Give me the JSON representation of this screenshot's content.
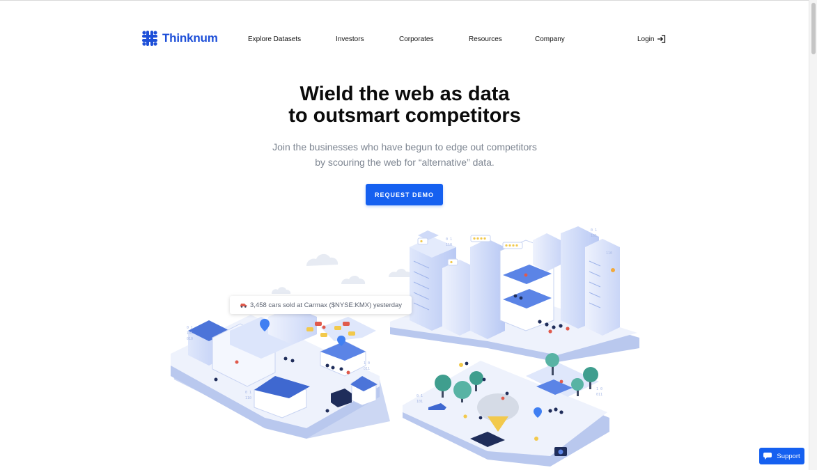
{
  "brand": {
    "name": "Thinknum",
    "color": "#1d4fd8"
  },
  "nav": {
    "items": [
      {
        "label": "Explore Datasets"
      },
      {
        "label": "Investors"
      },
      {
        "label": "Corporates"
      },
      {
        "label": "Resources"
      },
      {
        "label": "Company"
      }
    ],
    "login_label": "Login",
    "login_icon": "login-arrow-icon"
  },
  "hero": {
    "title_line1": "Wield the web as data",
    "title_line2": "to outsmart competitors",
    "subtitle_line1": "Join the businesses who have begun to edge out competitors",
    "subtitle_line2": "by scouring the web for “alternative” data.",
    "cta_label": "REQUEST DEMO",
    "accent": "#1560f0"
  },
  "illustration": {
    "tooltip_icon": "car-icon",
    "tooltip_text": "3,458 cars sold at Carmax ($NYSE:KMX) yesterday"
  },
  "support": {
    "label": "Support",
    "icon": "chat-icon"
  }
}
